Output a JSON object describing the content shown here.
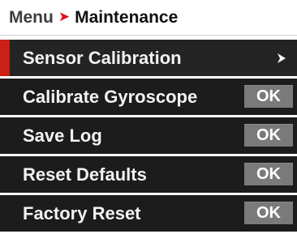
{
  "breadcrumb": {
    "root": "Menu",
    "separator": "➤",
    "current": "Maintenance"
  },
  "colors": {
    "accent": "#cc1f16",
    "row_background": "#1c1c1c",
    "button_background": "#7a7a7a",
    "text": "#f2f2f2"
  },
  "menu": {
    "items": [
      {
        "label": "Sensor Calibration",
        "kind": "submenu",
        "selected": true,
        "icon": "chevron-right-icon"
      },
      {
        "label": "Calibrate Gyroscope",
        "kind": "action",
        "button": "OK"
      },
      {
        "label": "Save Log",
        "kind": "action",
        "button": "OK"
      },
      {
        "label": "Reset Defaults",
        "kind": "action",
        "button": "OK"
      },
      {
        "label": "Factory Reset",
        "kind": "action",
        "button": "OK"
      }
    ]
  }
}
